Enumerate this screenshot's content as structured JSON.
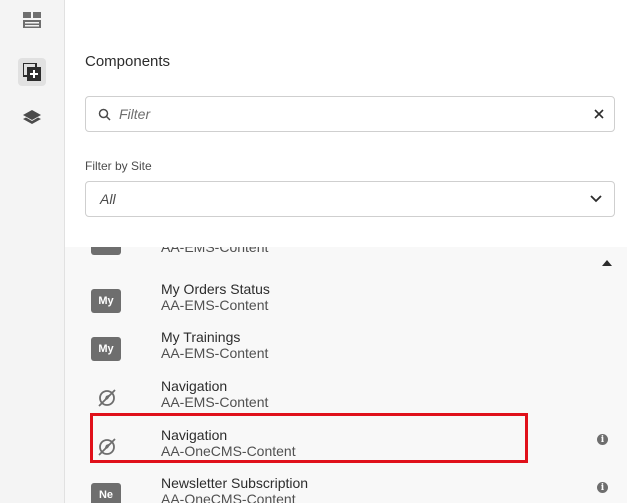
{
  "panel": {
    "title": "Components"
  },
  "search": {
    "placeholder": "Filter",
    "value": ""
  },
  "site_filter": {
    "label": "Filter by Site",
    "selected": "All"
  },
  "components": [
    {
      "badge": "",
      "name": "",
      "group": "AA-EMS-Content",
      "icon": "badge"
    },
    {
      "badge": "My",
      "name": "My Orders Status",
      "group": "AA-EMS-Content",
      "icon": "badge"
    },
    {
      "badge": "My",
      "name": "My Trainings",
      "group": "AA-EMS-Content",
      "icon": "badge"
    },
    {
      "badge": "",
      "name": "Navigation",
      "group": "AA-EMS-Content",
      "icon": "compass-slash-icon"
    },
    {
      "badge": "",
      "name": "Navigation",
      "group": "AA-OneCMS-Content",
      "icon": "compass-slash-icon",
      "highlighted": true,
      "info": true
    },
    {
      "badge": "Ne",
      "name": "Newsletter Subscription",
      "group": "AA-OneCMS-Content",
      "icon": "badge",
      "info": true
    }
  ],
  "colors": {
    "highlight": "#e0101a",
    "badge_bg": "#6e6e6e",
    "rail_bg": "#f4f4f4"
  }
}
